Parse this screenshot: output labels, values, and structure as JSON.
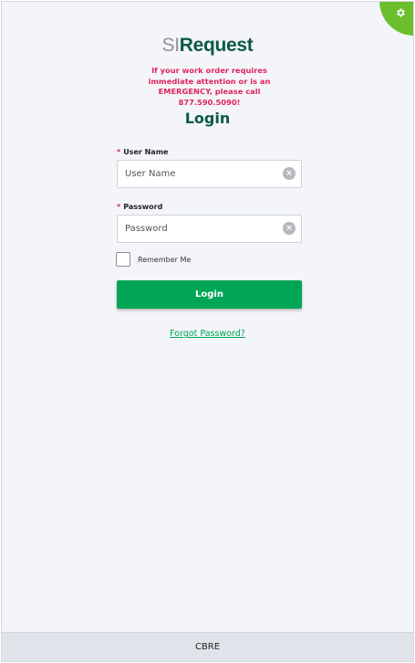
{
  "settings": {
    "icon": "gear-icon"
  },
  "logo": {
    "prefix": "SI",
    "name": "Request"
  },
  "notice": "If your work order requires immediate attention or is an EMERGENCY, please call 877.590.5090!",
  "form": {
    "title": "Login",
    "required_marker": "*",
    "username": {
      "label": "User Name",
      "placeholder": "User Name",
      "value": ""
    },
    "password": {
      "label": "Password",
      "placeholder": "Password",
      "value": ""
    },
    "remember_label": "Remember Me",
    "remember_checked": false,
    "submit_label": "Login",
    "forgot_label": "Forgot Password?"
  },
  "footer": {
    "text": "CBRE"
  },
  "colors": {
    "brand_green": "#00a656",
    "logo_green": "#0a5a45",
    "alert_red": "#e0245e",
    "corner_green": "#6bbf2c"
  }
}
